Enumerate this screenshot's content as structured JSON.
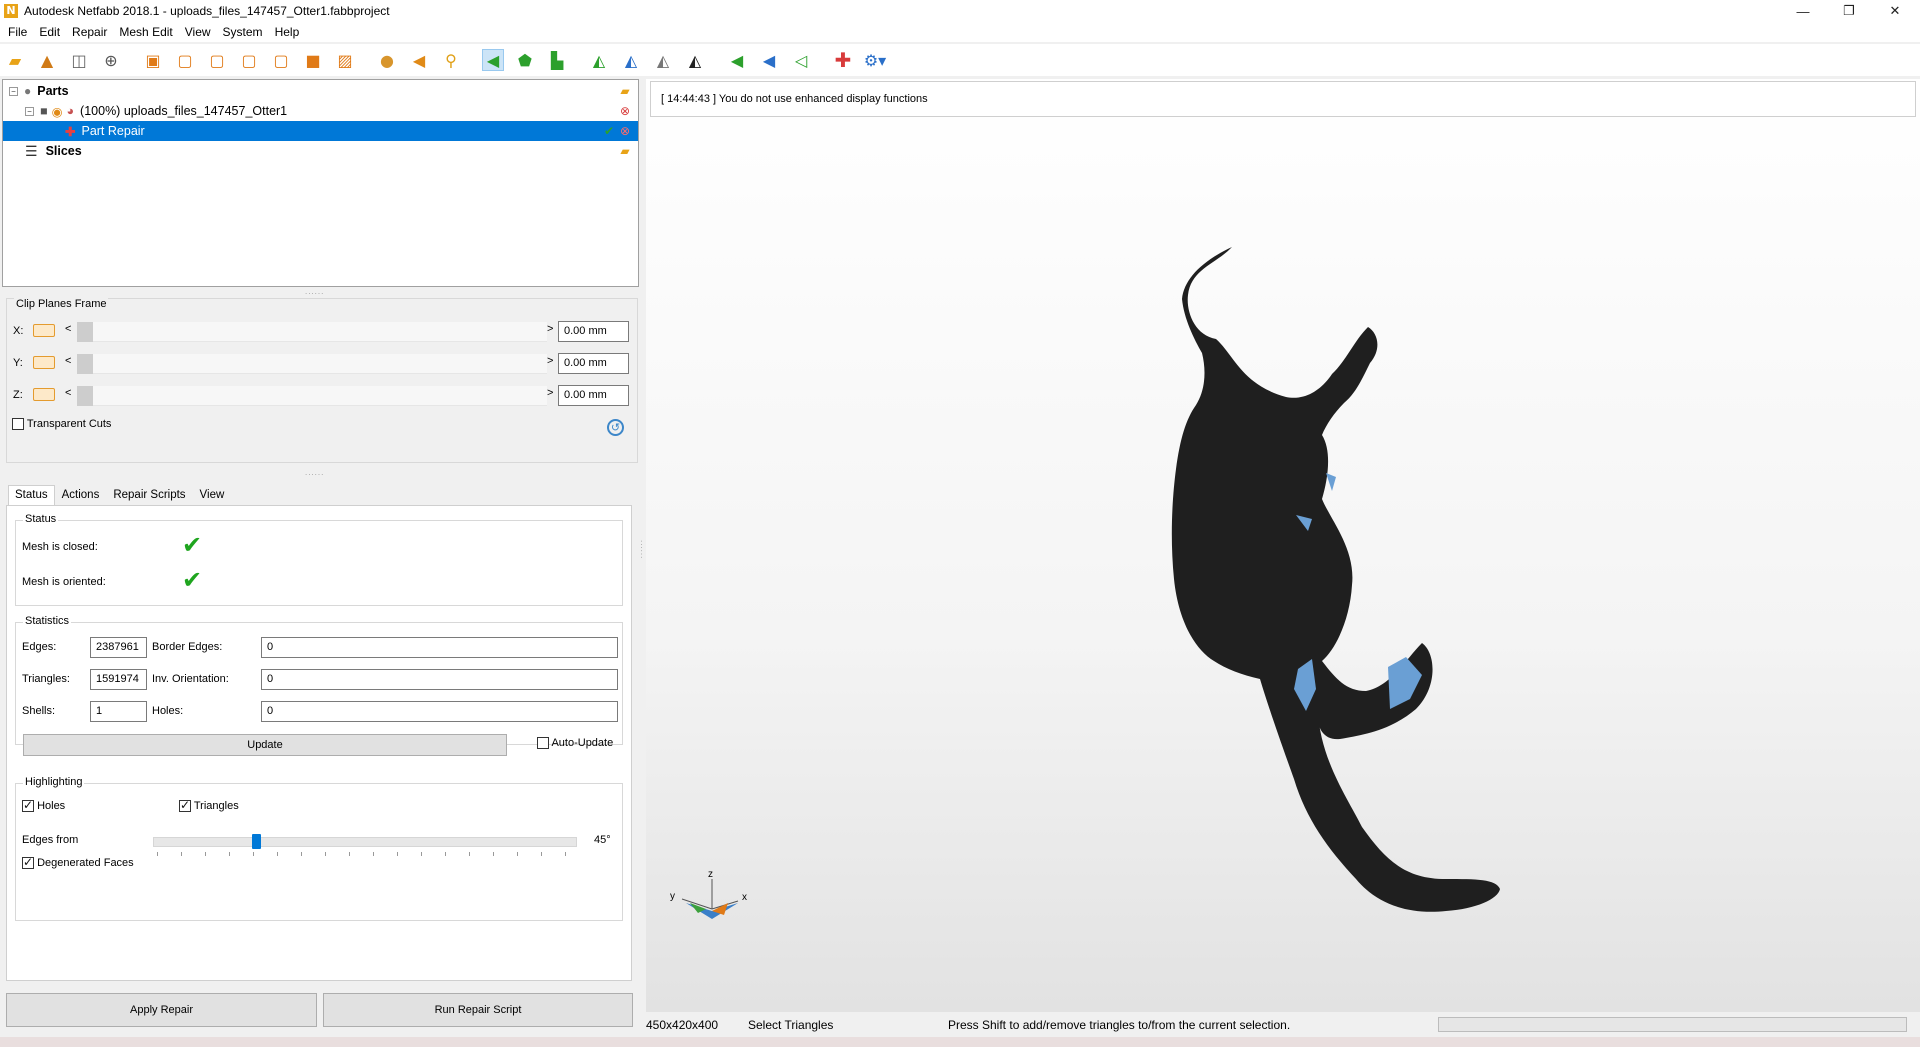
{
  "window": {
    "title": "Autodesk Netfabb 2018.1 - uploads_files_147457_Otter1.fabbproject",
    "app_icon_letter": "N",
    "minimize_glyph": "—",
    "restore_glyph": "❐",
    "close_glyph": "✕"
  },
  "menu": [
    "File",
    "Edit",
    "Repair",
    "Mesh Edit",
    "View",
    "System",
    "Help"
  ],
  "toolbar_icons": [
    "open-folder-icon",
    "add-part-icon",
    "new-project-icon",
    "add-mesh-icon",
    "view-front-icon",
    "view-back-icon",
    "view-left-icon",
    "view-right-icon",
    "view-top-icon",
    "view-bottom-icon",
    "view-iso-icon",
    "sphere-icon",
    "arrow-left-orange-icon",
    "zoom-icon",
    "select-triangles-icon",
    "select-surface-icon",
    "select-shell-icon",
    "add-triangle-icon",
    "select-brush-icon",
    "remove-triangle-icon",
    "invert-selection-icon",
    "triangle-green-icon",
    "triangle-blue-icon",
    "triangle-outline-icon",
    "add-part-repair-icon",
    "settings-dropdown-icon"
  ],
  "tree": {
    "parts_label": "Parts",
    "part_label": "(100%) uploads_files_147457_Otter1",
    "repair_label": "Part Repair",
    "slices_label": "Slices"
  },
  "clip_planes": {
    "title": "Clip Planes Frame",
    "rows": [
      {
        "axis": "X:",
        "value": "0.00 mm"
      },
      {
        "axis": "Y:",
        "value": "0.00 mm"
      },
      {
        "axis": "Z:",
        "value": "0.00 mm"
      }
    ],
    "transparent_cuts_label": "Transparent Cuts",
    "transparent_cuts_checked": false
  },
  "tabs": [
    "Status",
    "Actions",
    "Repair Scripts",
    "View"
  ],
  "active_tab": "Status",
  "status": {
    "group_title": "Status",
    "mesh_closed_label": "Mesh is closed:",
    "mesh_oriented_label": "Mesh is oriented:",
    "check_glyph": "✔"
  },
  "statistics": {
    "group_title": "Statistics",
    "edges_label": "Edges:",
    "edges_value": "2387961",
    "border_edges_label": "Border Edges:",
    "border_edges_value": "0",
    "triangles_label": "Triangles:",
    "triangles_value": "1591974",
    "inv_orientation_label": "Inv. Orientation:",
    "inv_orientation_value": "0",
    "shells_label": "Shells:",
    "shells_value": "1",
    "holes_label": "Holes:",
    "holes_value": "0",
    "update_label": "Update",
    "auto_update_label": "Auto-Update",
    "auto_update_checked": false
  },
  "highlighting": {
    "group_title": "Highlighting",
    "holes_label": "Holes",
    "holes_checked": true,
    "triangles_label": "Triangles",
    "triangles_checked": true,
    "edges_from_label": "Edges from",
    "edges_from_value": "45°",
    "edges_from_degrees": 45,
    "degenerated_label": "Degenerated Faces",
    "degenerated_checked": true
  },
  "buttons": {
    "apply_repair": "Apply Repair",
    "run_repair_script": "Run Repair Script"
  },
  "viewport": {
    "log_message": "[ 14:44:43 ] You do not use enhanced display functions",
    "axis_x": "x",
    "axis_y": "y",
    "axis_z": "z"
  },
  "statusbar": {
    "dimensions": "450x420x400",
    "mode": "Select Triangles",
    "hint": "Press Shift to add/remove triangles to/from the current selection."
  },
  "colors": {
    "selection": "#0078d7",
    "model": "#1f1f1f",
    "highlight_triangles": "#6a9fd4",
    "check_green": "#1fa51f",
    "delete_red": "#d83b3b"
  }
}
